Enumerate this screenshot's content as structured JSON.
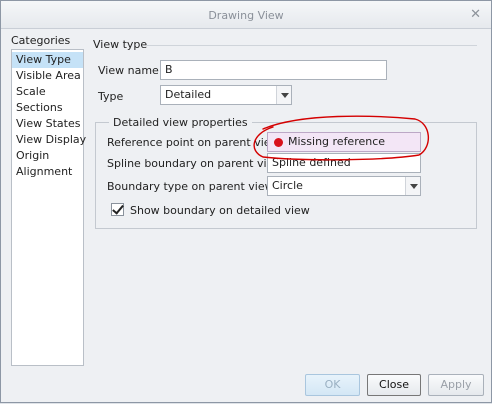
{
  "window": {
    "title": "Drawing View"
  },
  "categories": {
    "label": "Categories",
    "items": [
      "View Type",
      "Visible Area",
      "Scale",
      "Sections",
      "View States",
      "View Display",
      "Origin",
      "Alignment"
    ],
    "selected": "View Type"
  },
  "view_type": {
    "section_title": "View type",
    "view_name_label": "View name",
    "view_name_value": "B",
    "type_label": "Type",
    "type_value": "Detailed"
  },
  "detailed": {
    "group_title": "Detailed view properties",
    "ref_point_label": "Reference point on parent view",
    "ref_point_value": "Missing reference",
    "spline_label": "Spline boundary on parent view",
    "spline_value": "Spline defined",
    "boundary_label": "Boundary type on parent view",
    "boundary_value": "Circle",
    "show_boundary_label": "Show boundary on detailed view",
    "show_boundary_checked": true
  },
  "buttons": {
    "ok": "OK",
    "close": "Close",
    "apply": "Apply"
  },
  "colors": {
    "error_dot": "#d8111b",
    "annotation": "#d40000",
    "selection": "#c5e2f7"
  }
}
